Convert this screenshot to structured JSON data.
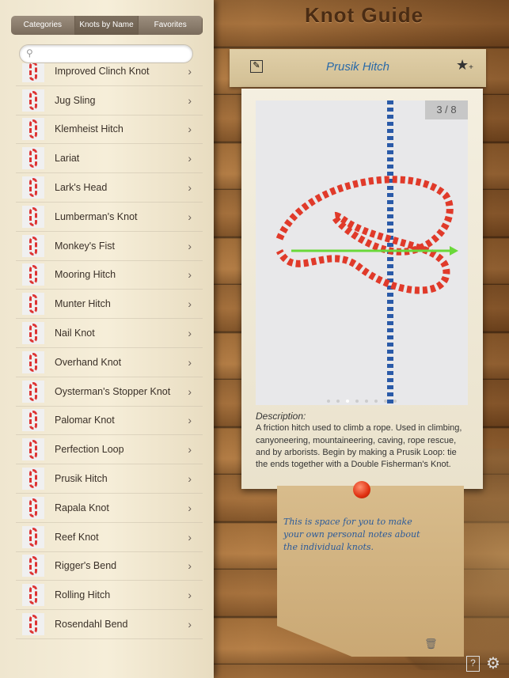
{
  "app_title": "Knot Guide",
  "tabs": [
    {
      "label": "Categories",
      "selected": false
    },
    {
      "label": "Knots by Name",
      "selected": true
    },
    {
      "label": "Favorites",
      "selected": false
    }
  ],
  "search": {
    "placeholder": "",
    "icon": "search-icon"
  },
  "knots": [
    "Improved Clinch Knot",
    "Jug Sling",
    "Klemheist Hitch",
    "Lariat",
    "Lark's Head",
    "Lumberman's Knot",
    "Monkey's Fist",
    "Mooring Hitch",
    "Munter Hitch",
    "Nail Knot",
    "Overhand Knot",
    "Oysterman's Stopper Knot",
    "Palomar Knot",
    "Perfection Loop",
    "Prusik Hitch",
    "Rapala Knot",
    "Reef Knot",
    "Rigger's Bend",
    "Rolling Hitch",
    "Rosendahl Bend"
  ],
  "detail": {
    "title": "Prusik Hitch",
    "counter": "3 / 8",
    "page_count": 8,
    "current_page": 3,
    "description_label": "Description:",
    "description": "A friction hitch used to climb a rope. Used in climbing, canyoneering, mountaineering, caving, rope rescue, and by arborists. Begin by making a Prusik Loop: tie the ends together with a Double Fisherman's Knot."
  },
  "note": {
    "text": "This is space for you to make your own personal notes about the individual knots."
  },
  "footer": {
    "help": "?"
  },
  "colors": {
    "title_blue": "#2a6aa8",
    "note_text": "#2a5a9a",
    "rope_red": "#e03a2a",
    "rope_blue": "#2a5aa8",
    "arrow_green": "#6ad83a"
  }
}
